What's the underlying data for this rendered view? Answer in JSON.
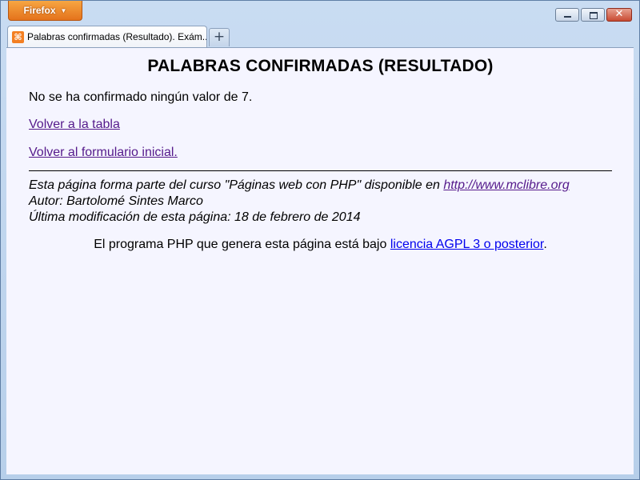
{
  "browser": {
    "menu_label": "Firefox",
    "menu_caret": "▼",
    "controls": {
      "minimize": "minimize",
      "maximize": "maximize",
      "close": "✕"
    },
    "tab": {
      "favicon": "xampp-icon",
      "favicon_glyph": "⌘",
      "title": "Palabras confirmadas (Resultado). Exám..."
    },
    "new_tab_glyph": "+"
  },
  "page": {
    "heading": "PALABRAS CONFIRMADAS (RESULTADO)",
    "message": "No se ha confirmado ningún valor de 7.",
    "link_back_table": "Volver a la tabla",
    "link_back_form": "Volver al formulario inicial.",
    "footer": {
      "course_prefix": "Esta página forma parte del curso \"Páginas web con PHP\" disponible en ",
      "course_link": "http://www.mclibre.org",
      "author": "Autor: Bartolomé Sintes Marco",
      "modified": "Última modificación de esta página: 18 de febrero de 2014"
    },
    "license": {
      "prefix": "El programa PHP que genera esta página está bajo ",
      "link": "licencia AGPL 3 o posterior",
      "suffix": "."
    }
  },
  "colors": {
    "visited_link": "#551a8b",
    "unvisited_link": "#0000ee",
    "page_background": "#f5f5ff",
    "firefox_button": "#e4731c"
  }
}
